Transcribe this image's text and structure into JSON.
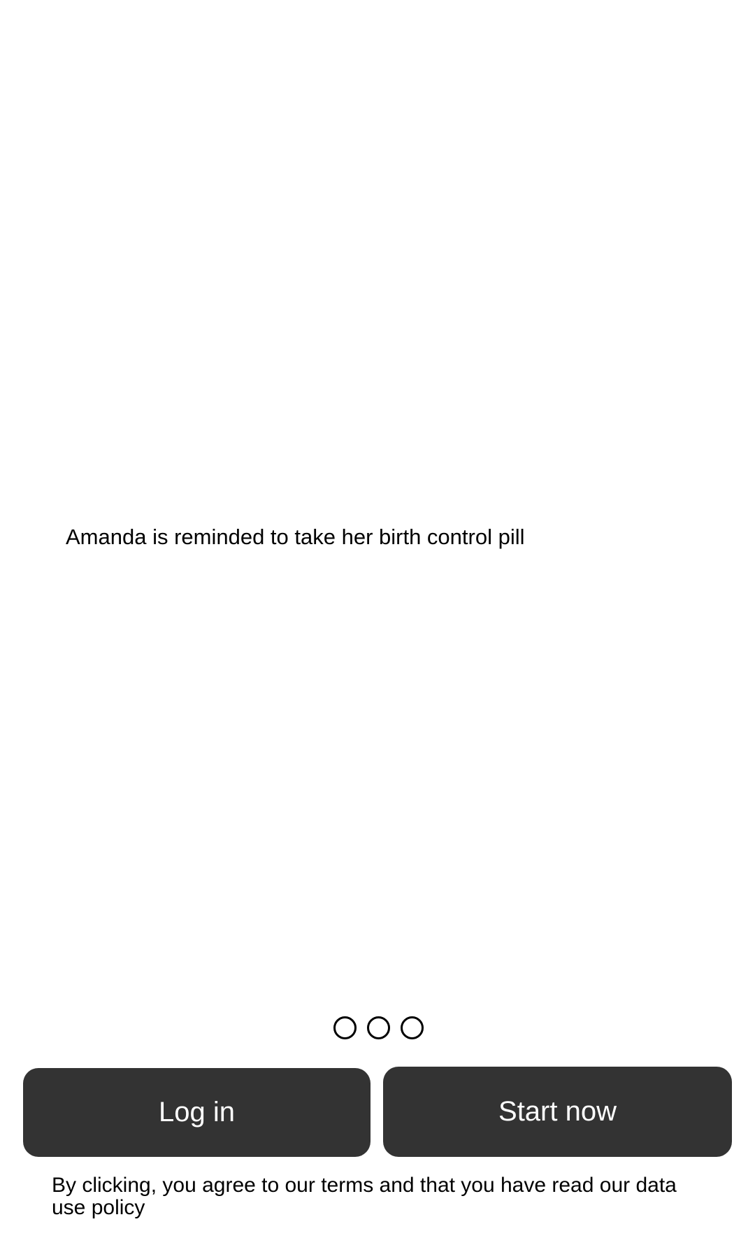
{
  "onboarding": {
    "slide_caption": "Amanda is reminded to take her birth control pill",
    "pager": {
      "total_pages": 3
    }
  },
  "actions": {
    "login_label": "Log in",
    "start_label": "Start now"
  },
  "legal": {
    "terms_text": "By clicking, you agree to our terms and that you have read our data use policy"
  },
  "colors": {
    "button_background": "#333333",
    "button_text": "#ffffff",
    "page_background": "#ffffff",
    "text": "#000000"
  }
}
